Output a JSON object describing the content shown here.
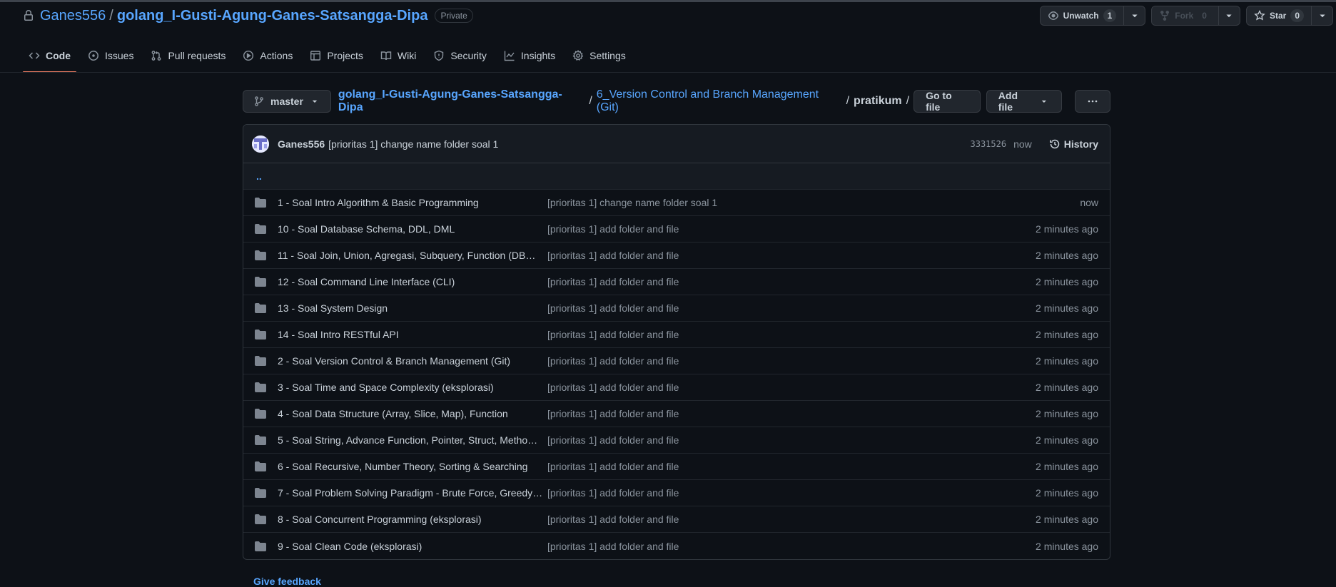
{
  "repo": {
    "owner": "Ganes556",
    "separator": "/",
    "name": "golang_I-Gusti-Agung-Ganes-Satsangga-Dipa",
    "visibility": "Private"
  },
  "header_buttons": {
    "unwatch_label": "Unwatch",
    "unwatch_count": "1",
    "fork_label": "Fork",
    "fork_count": "0",
    "star_label": "Star",
    "star_count": "0"
  },
  "tabs": [
    {
      "label": "Code",
      "icon": "code-icon",
      "active": true
    },
    {
      "label": "Issues",
      "icon": "issue-icon"
    },
    {
      "label": "Pull requests",
      "icon": "pull-request-icon"
    },
    {
      "label": "Actions",
      "icon": "play-icon"
    },
    {
      "label": "Projects",
      "icon": "table-icon"
    },
    {
      "label": "Wiki",
      "icon": "book-icon"
    },
    {
      "label": "Security",
      "icon": "shield-icon"
    },
    {
      "label": "Insights",
      "icon": "graph-icon"
    },
    {
      "label": "Settings",
      "icon": "gear-icon"
    }
  ],
  "nav": {
    "branch": "master",
    "crumb_root": "golang_I-Gusti-Agung-Ganes-Satsangga-Dipa",
    "crumb_mid": "6_Version Control and Branch Management (Git)",
    "crumb_last": "pratikum",
    "slash": "/",
    "go_to_file": "Go to file",
    "add_file": "Add file"
  },
  "commit": {
    "author": "Ganes556",
    "message": "[prioritas 1] change name folder soal 1",
    "sha": "3331526",
    "when": "now",
    "history": "History"
  },
  "up_dir": "..",
  "files": [
    {
      "name": "1 - Soal Intro Algorithm & Basic Programming",
      "message": "[prioritas 1] change name folder soal 1",
      "age": "now"
    },
    {
      "name": "10 - Soal Database Schema, DDL, DML",
      "message": "[prioritas 1] add folder and file",
      "age": "2 minutes ago"
    },
    {
      "name": "11 - Soal Join, Union, Agregasi, Subquery, Function (DB…",
      "message": "[prioritas 1] add folder and file",
      "age": "2 minutes ago"
    },
    {
      "name": "12 - Soal Command Line Interface (CLI)",
      "message": "[prioritas 1] add folder and file",
      "age": "2 minutes ago"
    },
    {
      "name": "13 - Soal System Design",
      "message": "[prioritas 1] add folder and file",
      "age": "2 minutes ago"
    },
    {
      "name": "14 - Soal Intro RESTful API",
      "message": "[prioritas 1] add folder and file",
      "age": "2 minutes ago"
    },
    {
      "name": "2 - Soal Version Control & Branch Management (Git)",
      "message": "[prioritas 1] add folder and file",
      "age": "2 minutes ago"
    },
    {
      "name": "3 - Soal Time and Space Complexity (eksplorasi)",
      "message": "[prioritas 1] add folder and file",
      "age": "2 minutes ago"
    },
    {
      "name": "4 - Soal Data Structure (Array, Slice, Map), Function",
      "message": "[prioritas 1] add folder and file",
      "age": "2 minutes ago"
    },
    {
      "name": "5 - Soal String, Advance Function, Pointer, Struct, Metho…",
      "message": "[prioritas 1] add folder and file",
      "age": "2 minutes ago"
    },
    {
      "name": "6 - Soal Recursive, Number Theory, Sorting & Searching",
      "message": "[prioritas 1] add folder and file",
      "age": "2 minutes ago"
    },
    {
      "name": "7 - Soal Problem Solving Paradigm - Brute Force, Greedy…",
      "message": "[prioritas 1] add folder and file",
      "age": "2 minutes ago"
    },
    {
      "name": "8 - Soal Concurrent Programming (eksplorasi)",
      "message": "[prioritas 1] add folder and file",
      "age": "2 minutes ago"
    },
    {
      "name": "9 - Soal Clean Code (eksplorasi)",
      "message": "[prioritas 1] add folder and file",
      "age": "2 minutes ago"
    }
  ],
  "feedback": "Give feedback",
  "colors": {
    "background": "#0d1117",
    "link": "#58a6ff",
    "active_tab_underline": "#f78166",
    "folder": "#7d8590"
  }
}
